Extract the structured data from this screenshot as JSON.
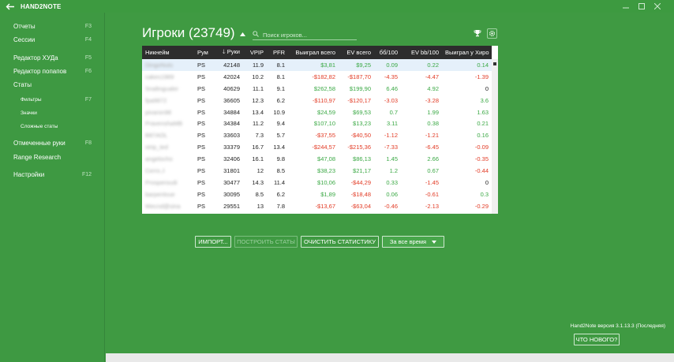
{
  "titlebar": {
    "app_name": "HAND2NOTE"
  },
  "sidebar": {
    "items": [
      {
        "label": "Отчеты",
        "key": "F3"
      },
      {
        "label": "Сессии",
        "key": "F4"
      },
      {
        "label": "Редактор ХУДа",
        "key": "F5"
      },
      {
        "label": "Редактор попапов",
        "key": "F6"
      },
      {
        "label": "Статы",
        "key": ""
      },
      {
        "label": "Фильтры",
        "key": "F7"
      },
      {
        "label": "Значки",
        "key": ""
      },
      {
        "label": "Сложные статы",
        "key": ""
      },
      {
        "label": "Отмеченные руки",
        "key": "F8"
      },
      {
        "label": "Range Research",
        "key": ""
      },
      {
        "label": "Настройки",
        "key": "F12"
      }
    ]
  },
  "main": {
    "title": "Игроки (23749)",
    "search_placeholder": "Поиск игроков..."
  },
  "table": {
    "columns": [
      "Никнейм",
      "Рум",
      "Руки",
      "VPIP",
      "PFR",
      "Выиграл всего",
      "EV всего",
      "бб/100",
      "EV bb/100",
      "Выиграл у Хиро"
    ],
    "sort_arrow": "🡓",
    "rows": [
      [
        "DingoNuts",
        "PS",
        "42148",
        "11.9",
        "8.1",
        "$3,81",
        "$9,25",
        "0.09",
        "0.22",
        "0.14"
      ],
      [
        "cakes1989",
        "PS",
        "42024",
        "10.2",
        "8.1",
        "-$182,82",
        "-$187,70",
        "-4.35",
        "-4.47",
        "-1.39"
      ],
      [
        "Snaltngualer",
        "PS",
        "40629",
        "11.1",
        "9.1",
        "$262,58",
        "$199,90",
        "6.46",
        "4.92",
        "0"
      ],
      [
        "fpa9872",
        "PS",
        "36605",
        "12.3",
        "6.2",
        "-$110,97",
        "-$120,17",
        "-3.03",
        "-3.28",
        "3.6"
      ],
      [
        "pivaron98",
        "PS",
        "34884",
        "13.4",
        "10.9",
        "$24,59",
        "$69,53",
        "0.7",
        "1.99",
        "1.63"
      ],
      [
        "PravenshaMB",
        "PS",
        "34384",
        "11.2",
        "9.4",
        "$107,10",
        "$13,23",
        "3.11",
        "0.38",
        "0.21"
      ],
      [
        "B87AOL",
        "PS",
        "33603",
        "7.3",
        "5.7",
        "-$37,55",
        "-$40,50",
        "-1.12",
        "-1.21",
        "0.16"
      ],
      [
        "strip_ted",
        "PS",
        "33379",
        "16.7",
        "13.4",
        "-$244,57",
        "-$215,36",
        "-7.33",
        "-6.45",
        "-0.09"
      ],
      [
        "angelocho",
        "PS",
        "32406",
        "16.1",
        "9.8",
        "$47,08",
        "$86,13",
        "1.45",
        "2.66",
        "-0.35"
      ],
      [
        "Cerro.J",
        "PS",
        "31801",
        "12",
        "8.5",
        "$38,23",
        "$21,17",
        "1.2",
        "0.67",
        "-0.44"
      ],
      [
        "Prosperoudi",
        "PS",
        "30477",
        "14.3",
        "11.4",
        "$10,06",
        "-$44,29",
        "0.33",
        "-1.45",
        "0"
      ],
      [
        "barpenloue",
        "PS",
        "30095",
        "8.5",
        "6.2",
        "$1,89",
        "-$18,48",
        "0.06",
        "-0.61",
        "0.3"
      ],
      [
        "Wecnd@sina",
        "PS",
        "29551",
        "13",
        "7.8",
        "-$13,67",
        "-$63,04",
        "-0.46",
        "-2.13",
        "-0.29"
      ]
    ]
  },
  "buttons": {
    "import": "ИМПОРТ...",
    "build_stats": "ПОСТРОИТЬ СТАТЫ",
    "clear_stats": "ОЧИСТИТЬ СТАТИСТИКУ",
    "period": "За все время"
  },
  "footer": {
    "version": "Hand2Note версия 3.1.13.3 (Последняя)",
    "whats_new": "ЧТО НОВОГО?"
  },
  "colors": {
    "background": "#3f9a42",
    "positive": "#3aa844",
    "negative": "#e23a24",
    "header": "#2d2d2d"
  },
  "icons": [
    "back-arrow-icon",
    "minimize-icon",
    "maximize-icon",
    "close-icon",
    "search-icon",
    "trophy-icon",
    "gear-icon",
    "sort-down-icon",
    "dropdown-caret-icon"
  ]
}
